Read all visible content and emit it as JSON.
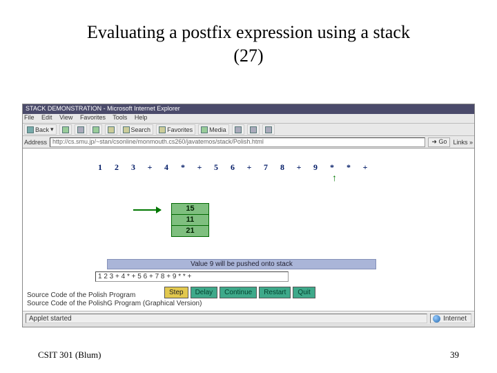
{
  "slide": {
    "title_line1": "Evaluating a postfix expression using a stack",
    "title_line2": "(27)",
    "footer_left": "CSIT 301 (Blum)",
    "footer_right": "39"
  },
  "browser": {
    "titlebar": "STACK DEMONSTRATION - Microsoft Internet Explorer",
    "menus": [
      "File",
      "Edit",
      "View",
      "Favorites",
      "Tools",
      "Help"
    ],
    "toolbar": {
      "back": "Back",
      "search": "Search",
      "favorites": "Favorites",
      "media": "Media"
    },
    "address_label": "Address",
    "address_value": "http://cs.smu.jp/~stan/csonline/monmouth.cs260/javatemos/stack/Polish.html",
    "go_label": "Go",
    "links_label": "Links »",
    "status_left": "Applet started",
    "status_right": "Internet"
  },
  "applet": {
    "tokens": [
      "1",
      "2",
      "3",
      "+",
      "4",
      "*",
      "+",
      "5",
      "6",
      "+",
      "7",
      "8",
      "+",
      "9",
      "*",
      "*",
      "+"
    ],
    "stack": [
      "15",
      "11",
      "21"
    ],
    "message": "Value 9 will be pushed onto stack",
    "expression": "1 2 3 + 4 * + 5 6 + 7 8 + 9 * * +",
    "buttons": {
      "step": "Step",
      "delay": "Delay",
      "continue": "Continue",
      "restart": "Restart",
      "quit": "Quit"
    },
    "link1": "Source Code of the Polish Program",
    "link2": "Source Code of the PolishG Program (Graphical Version)"
  }
}
